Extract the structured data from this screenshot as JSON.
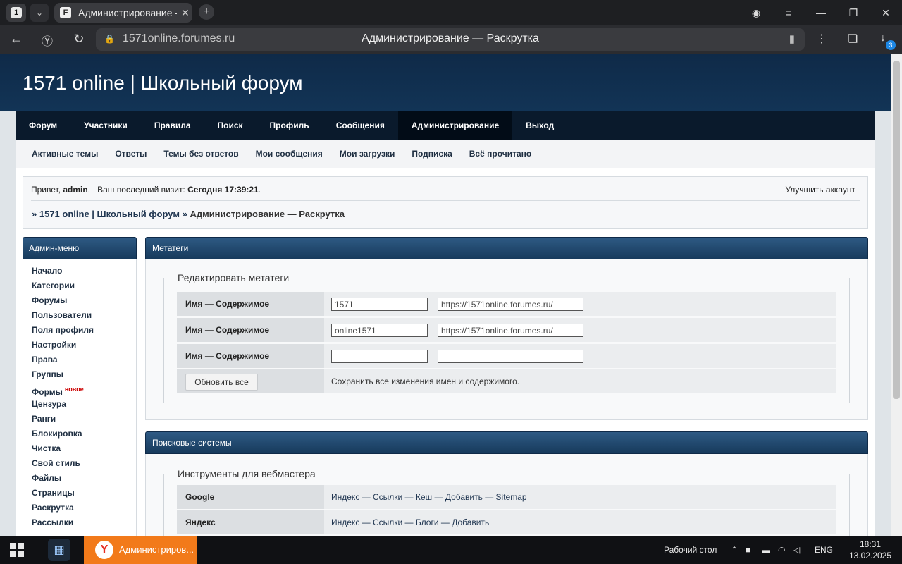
{
  "browser": {
    "tab_count": "1",
    "tab_title": "Администрирование -",
    "tab_favicon": "F",
    "host": "1571online.forumes.ru",
    "page_title": "Администрирование — Раскрутка",
    "downloads_badge": "3"
  },
  "site": {
    "title": "1571 online | Школьный форум"
  },
  "mainnav": [
    "Форум",
    "Участники",
    "Правила",
    "Поиск",
    "Профиль",
    "Сообщения",
    "Администрирование",
    "Выход"
  ],
  "subnav": [
    "Активные темы",
    "Ответы",
    "Темы без ответов",
    "Мои сообщения",
    "Мои загрузки",
    "Подписка",
    "Всё прочитано"
  ],
  "welcome": {
    "greeting": "Привет,",
    "user": "admin",
    "last_visit_label": "Ваш последний визит:",
    "last_visit_value": "Сегодня 17:39:21",
    "upgrade": "Улучшить аккаунт",
    "crumb_prefix": "»",
    "crumb_forum": "1571 online | Школьный форум",
    "crumb_sep": "»",
    "crumb_current": "Администрирование — Раскрутка"
  },
  "admin_menu": {
    "title": "Админ-меню",
    "items": [
      "Начало",
      "Категории",
      "Форумы",
      "Пользователи",
      "Поля профиля",
      "Настройки",
      "Права",
      "Группы",
      "Формы",
      "Цензура",
      "Ранги",
      "Блокировка",
      "Чистка",
      "Свой стиль",
      "Файлы",
      "Страницы",
      "Раскрутка",
      "Рассылки"
    ],
    "new_badge": "новое"
  },
  "meta_panel": {
    "title": "Метатеги",
    "legend": "Редактировать метатеги",
    "rows": [
      {
        "label": "Имя — Содержимое",
        "name": "1571",
        "content": "https://1571online.forumes.ru/"
      },
      {
        "label": "Имя — Содержимое",
        "name": "online1571",
        "content": "https://1571online.forumes.ru/"
      },
      {
        "label": "Имя — Содержимое",
        "name": "",
        "content": ""
      }
    ],
    "button": "Обновить все",
    "hint": "Сохранить все изменения имен и содержимого."
  },
  "search_panel": {
    "title": "Поисковые системы",
    "legend": "Инструменты для вебмастера",
    "rows": [
      {
        "label": "Google",
        "links": "Индекс — Ссылки — Кеш — Добавить — Sitemap"
      },
      {
        "label": "Яндекс",
        "links": "Индекс — Ссылки — Блоги — Добавить"
      }
    ]
  },
  "taskbar": {
    "active_label": "Администриров...",
    "desktop": "Рабочий стол",
    "lang": "ENG",
    "time": "18:31",
    "date": "13.02.2025"
  }
}
